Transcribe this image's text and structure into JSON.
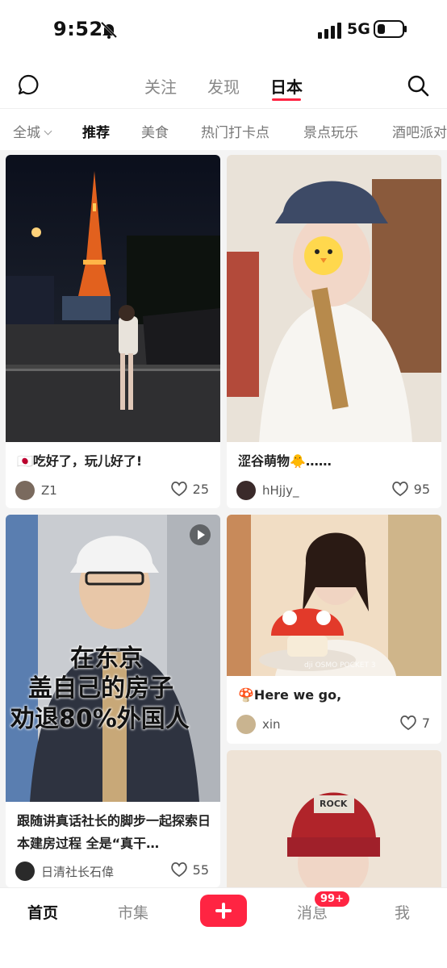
{
  "status": {
    "time": "9:52",
    "network": "5G"
  },
  "topnav": {
    "tabs": [
      "关注",
      "发现",
      "日本"
    ],
    "active_tab": "日本"
  },
  "chips": [
    "全城",
    "推荐",
    "美食",
    "热门打卡点",
    "景点玩乐",
    "酒吧派对"
  ],
  "feed": [
    {
      "title": "🇯🇵吃好了，玩儿好了!",
      "author": "Z1",
      "likes": "25"
    },
    {
      "title": "涩谷萌物🐥……",
      "author": "hHjjy_",
      "likes": "95"
    },
    {
      "title": "跟随讲真话社长的脚步一起探索日本建房过程 全是“真干…",
      "author": "日清社长石偉",
      "likes": "55",
      "cover_text": [
        "在东京",
        "盖自己的房子",
        "劝退80%外国人"
      ]
    },
    {
      "title": "🍄Here we go,",
      "author": "xin",
      "likes": "7",
      "watermark": "dji OSMO POCKET 3"
    },
    {
      "title": "",
      "author": "",
      "likes": "",
      "hat_text": "ROCK"
    }
  ],
  "bottom_nav": {
    "home": "首页",
    "market": "市集",
    "messages": "消息",
    "me": "我",
    "badge": "99+"
  },
  "colors": {
    "accent": "#ff2442"
  }
}
